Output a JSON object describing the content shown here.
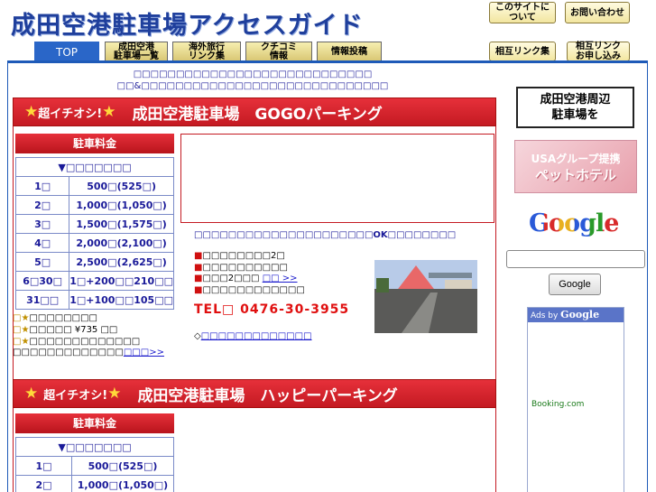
{
  "header": {
    "logo": "成田空港駐車場アクセスガイド",
    "about_label": "このサイトに\nついて",
    "contact_label": "お問い合わせ",
    "mutual_links_label": "相互リンク集",
    "link_request_label": "相互リンク\nお申し込み"
  },
  "tabs": [
    {
      "label": "TOP"
    },
    {
      "label": "成田空港\n駐車場一覧"
    },
    {
      "label": "海外旅行\nリンク集"
    },
    {
      "label": "クチコミ\n情報"
    },
    {
      "label": "情報投稿"
    }
  ],
  "notice": {
    "line1": "□□□□□□□□□□□□□□□□□□□□□□□□□□□□",
    "line2": "□□&□□□□□□□□□□□□□□□□□□□□□□□□□□□□□"
  },
  "section1": {
    "star1": "★",
    "tag": "超イチオシ!",
    "star2": "★",
    "name": "成田空港駐車場　GOGOパーキング",
    "fee_title": "駐車料金",
    "fee_subtitle": "▼□□□□□□□",
    "fees": [
      {
        "days": "1□",
        "price": "500□(525□)"
      },
      {
        "days": "2□",
        "price": "1,000□(1,050□)"
      },
      {
        "days": "3□",
        "price": "1,500□(1,575□)"
      },
      {
        "days": "4□",
        "price": "2,000□(2,100□)"
      },
      {
        "days": "5□",
        "price": "2,500□(2,625□)"
      },
      {
        "days": "6□30□",
        "price": "1□+200□□210□□"
      },
      {
        "days": "31□□",
        "price": "1□+100□□105□□"
      }
    ],
    "info": [
      {
        "mark": "□★",
        "text": "□□□□□□□□"
      },
      {
        "mark": "□★",
        "text": "□□□□□ ¥735 □□"
      },
      {
        "mark": "□★",
        "text": "□□□□□□□□□□□□□"
      },
      {
        "mark": "□",
        "text": "□□□□□□□□□□□□",
        "link": "□□□>>"
      }
    ],
    "description": "□□□□□□□□□□□□□□□□□□□□□OK□□□□□□□□",
    "features": [
      {
        "sq": "■",
        "text": "□□□□□□□□2□"
      },
      {
        "sq": "■",
        "text": "□□□□□□□□□□"
      },
      {
        "sq": "■",
        "text": "□□□2□□□ ",
        "link": "□□ >>"
      },
      {
        "sq": "■",
        "text": "□□□□□□□□□□□□"
      }
    ],
    "tel": "TEL□ 0476-30-3955",
    "more_prefix": "◇",
    "more_link": "□□□□□□□□□□□□□"
  },
  "section2": {
    "star1": "★",
    "tag": "超イチオシ!",
    "star2": "★",
    "name": "成田空港駐車場　ハッピーパーキング",
    "fee_title": "駐車料金",
    "fee_subtitle": "▼□□□□□□□",
    "fees": [
      {
        "days": "1□",
        "price": "500□(525□)"
      },
      {
        "days": "2□",
        "price": "1,000□(1,050□)"
      }
    ]
  },
  "sidebar": {
    "banner_dark": "成田空港周辺\n駐車場を",
    "pet_line1": "USAグループ提携",
    "pet_line2": "ペットホテル",
    "google_logo": "Google",
    "search_value": "",
    "google_button": "Google",
    "ads_prefix": "Ads by ",
    "ads_brand": "Google",
    "ads_link": "Booking.com"
  },
  "colors": {
    "header_blue": "#1f3f9c",
    "accent_red": "#c41a22",
    "tab_blue": "#2a66c8",
    "link_blue": "#1a1acc"
  }
}
